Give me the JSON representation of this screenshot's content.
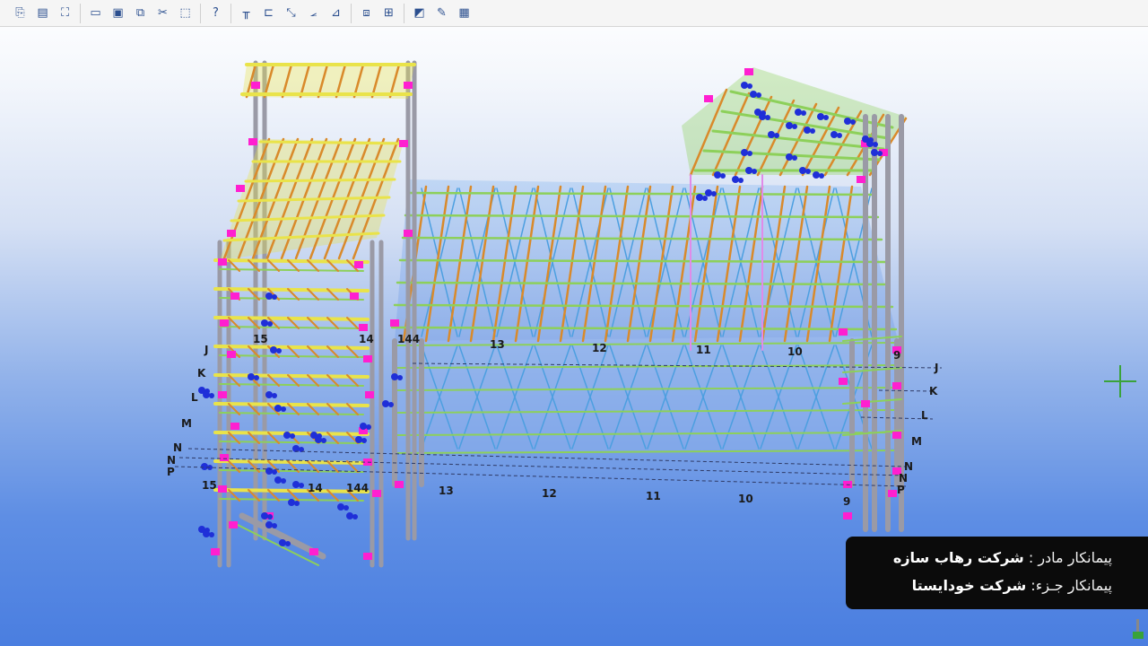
{
  "toolbar": {
    "groups": [
      {
        "buttons": [
          {
            "icon": "new-model-icon",
            "glyph": "⎘"
          },
          {
            "icon": "open-model-icon",
            "glyph": "▤"
          },
          {
            "icon": "save-model-icon",
            "glyph": "⛶"
          }
        ]
      },
      {
        "buttons": [
          {
            "icon": "window-icon",
            "glyph": "▭"
          },
          {
            "icon": "view-icon",
            "glyph": "▣"
          },
          {
            "icon": "copy-view-icon",
            "glyph": "⧉"
          },
          {
            "icon": "scissors-icon",
            "glyph": "✂"
          },
          {
            "icon": "select-icon",
            "glyph": "⬚"
          }
        ]
      },
      {
        "buttons": [
          {
            "icon": "help-icon",
            "glyph": "?"
          }
        ]
      },
      {
        "buttons": [
          {
            "icon": "grid-icon",
            "glyph": "╥"
          },
          {
            "icon": "angle-icon",
            "glyph": "⊏"
          },
          {
            "icon": "measure-icon",
            "glyph": "⤡"
          },
          {
            "icon": "snap-icon",
            "glyph": "⦟"
          },
          {
            "icon": "plane-icon",
            "glyph": "⊿"
          }
        ]
      },
      {
        "buttons": [
          {
            "icon": "layers-icon",
            "glyph": "⧈"
          },
          {
            "icon": "properties-icon",
            "glyph": "⊞"
          }
        ]
      },
      {
        "buttons": [
          {
            "icon": "render-icon",
            "glyph": "◩"
          },
          {
            "icon": "paint-icon",
            "glyph": "✎"
          },
          {
            "icon": "report-icon",
            "glyph": "▦"
          }
        ]
      }
    ]
  },
  "grid_labels": {
    "letters_left": [
      "J",
      "K",
      "L",
      "M",
      "N",
      "N",
      "P"
    ],
    "letters_right": [
      "J",
      "K",
      "L",
      "M",
      "N",
      "N",
      "P"
    ],
    "numbers_top": [
      "15",
      "14",
      "144",
      "13",
      "12",
      "11",
      "10",
      "9"
    ],
    "numbers_bottom": [
      "15",
      "14",
      "144",
      "13",
      "12",
      "11",
      "10",
      "9"
    ]
  },
  "credits": {
    "main_contractor_label": "پیمانکار مادر :",
    "main_contractor_value": "شرکت رهاب سازه",
    "sub_contractor_label": "پیمانکار جـزء:",
    "sub_contractor_value": "شرکت خودایستا"
  },
  "colors": {
    "beam_yellow": "#e9e34a",
    "beam_orange": "#d98a2b",
    "beam_green": "#8dd05a",
    "column_gray": "#9a9aa6",
    "plate_magenta": "#ff1fd0",
    "bolt_blue": "#1f2fd8",
    "brace_blue": "#4c9fe0"
  }
}
